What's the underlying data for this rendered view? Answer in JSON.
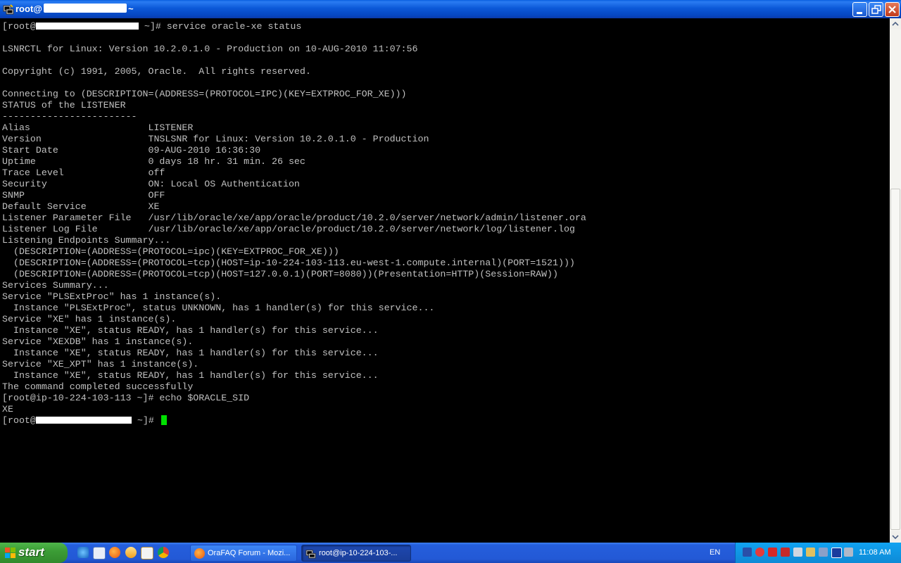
{
  "window": {
    "title": "root@",
    "title_suffix": "~"
  },
  "terminal": {
    "lines": [
      {
        "text": "[root@",
        "redact_w": 146,
        "after": " ~]# service oracle-xe status"
      },
      {
        "text": ""
      },
      {
        "text": "LSNRCTL for Linux: Version 10.2.0.1.0 - Production on 10-AUG-2010 11:07:56"
      },
      {
        "text": ""
      },
      {
        "text": "Copyright (c) 1991, 2005, Oracle.  All rights reserved."
      },
      {
        "text": ""
      },
      {
        "text": "Connecting to (DESCRIPTION=(ADDRESS=(PROTOCOL=IPC)(KEY=EXTPROC_FOR_XE)))"
      },
      {
        "text": "STATUS of the LISTENER"
      },
      {
        "text": "------------------------"
      },
      {
        "text": "Alias                     LISTENER"
      },
      {
        "text": "Version                   TNSLSNR for Linux: Version 10.2.0.1.0 - Production"
      },
      {
        "text": "Start Date                09-AUG-2010 16:36:30"
      },
      {
        "text": "Uptime                    0 days 18 hr. 31 min. 26 sec"
      },
      {
        "text": "Trace Level               off"
      },
      {
        "text": "Security                  ON: Local OS Authentication"
      },
      {
        "text": "SNMP                      OFF"
      },
      {
        "text": "Default Service           XE"
      },
      {
        "text": "Listener Parameter File   /usr/lib/oracle/xe/app/oracle/product/10.2.0/server/network/admin/listener.ora"
      },
      {
        "text": "Listener Log File         /usr/lib/oracle/xe/app/oracle/product/10.2.0/server/network/log/listener.log"
      },
      {
        "text": "Listening Endpoints Summary..."
      },
      {
        "text": "  (DESCRIPTION=(ADDRESS=(PROTOCOL=ipc)(KEY=EXTPROC_FOR_XE)))"
      },
      {
        "text": "  (DESCRIPTION=(ADDRESS=(PROTOCOL=tcp)(HOST=ip-10-224-103-113.eu-west-1.compute.internal)(PORT=1521)))"
      },
      {
        "text": "  (DESCRIPTION=(ADDRESS=(PROTOCOL=tcp)(HOST=127.0.0.1)(PORT=8080))(Presentation=HTTP)(Session=RAW))"
      },
      {
        "text": "Services Summary..."
      },
      {
        "text": "Service \"PLSExtProc\" has 1 instance(s)."
      },
      {
        "text": "  Instance \"PLSExtProc\", status UNKNOWN, has 1 handler(s) for this service..."
      },
      {
        "text": "Service \"XE\" has 1 instance(s)."
      },
      {
        "text": "  Instance \"XE\", status READY, has 1 handler(s) for this service..."
      },
      {
        "text": "Service \"XEXDB\" has 1 instance(s)."
      },
      {
        "text": "  Instance \"XE\", status READY, has 1 handler(s) for this service..."
      },
      {
        "text": "Service \"XE_XPT\" has 1 instance(s)."
      },
      {
        "text": "  Instance \"XE\", status READY, has 1 handler(s) for this service..."
      },
      {
        "text": "The command completed successfully"
      },
      {
        "text": "[root@ip-10-224-103-113 ~]# echo $ORACLE_SID"
      },
      {
        "text": "XE"
      },
      {
        "text": "[root@",
        "redact_w": 136,
        "after": " ~]# ",
        "cursor": true
      }
    ]
  },
  "taskbar": {
    "start_label": "start",
    "tasks": [
      {
        "label": "OraFAQ Forum - Mozi..."
      },
      {
        "label": "root@ip-10-224-103-..."
      }
    ],
    "language": "EN",
    "clock": "11:08 AM"
  },
  "colors": {
    "terminal_bg": "#000000",
    "terminal_fg": "#c0c0c0",
    "cursor": "#00e000",
    "titlebar": "#0b58d8",
    "taskbar": "#245edc",
    "start": "#3c9d36",
    "tray": "#0e8ad6"
  }
}
